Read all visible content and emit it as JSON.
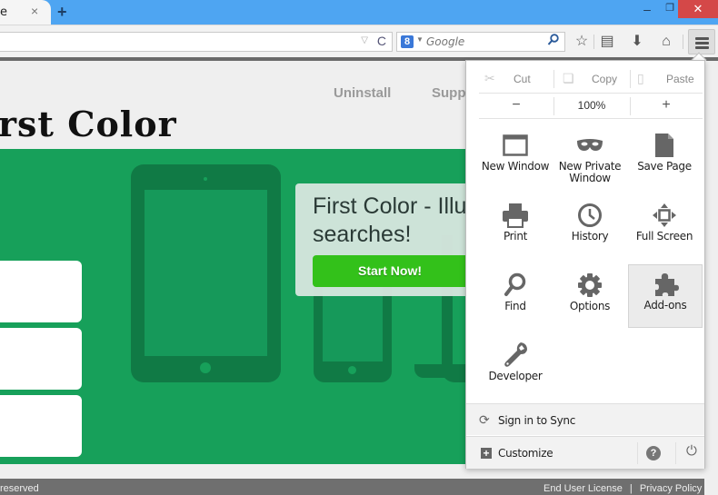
{
  "browser": {
    "tab_title": "e",
    "tab_close_icon": "×",
    "new_tab_icon": "+",
    "window_controls": {
      "minimize": "–",
      "maximize": "❐",
      "close": "✕"
    },
    "urlbar": {
      "value": "",
      "dropdown_icon": "▽",
      "reload_icon": "C"
    },
    "searchbar": {
      "engine_letter": "8",
      "placeholder": "Google",
      "go_icon": "⚲"
    },
    "toolbar_icons": {
      "bookmark": "☆",
      "reading_list": "▤",
      "download": "⬇",
      "home": "⌂"
    }
  },
  "site": {
    "logo": "rst Color",
    "nav": [
      "Uninstall",
      "Supp"
    ],
    "promo_title_line1": "First Color - Illu",
    "promo_title_line2": "searches!",
    "cta_label": "Start Now!",
    "footer_left": "reserved",
    "footer_links": [
      "End User License",
      "Privacy Policy"
    ],
    "footer_sep": "|",
    "colors": {
      "hero_green": "#17a05a",
      "device_green": "#107a45",
      "cta_green": "#33c11a"
    }
  },
  "menu": {
    "edit": [
      {
        "label": "Cut",
        "icon": "✂"
      },
      {
        "label": "Copy",
        "icon": "❏"
      },
      {
        "label": "Paste",
        "icon": "▯"
      }
    ],
    "zoom": {
      "minus": "−",
      "value": "100%",
      "plus": "+"
    },
    "items": [
      {
        "label": "New Window",
        "icon": "new-window"
      },
      {
        "label": "New Private Window",
        "icon": "mask"
      },
      {
        "label": "Save Page",
        "icon": "page"
      },
      {
        "label": "Print",
        "icon": "printer"
      },
      {
        "label": "History",
        "icon": "clock"
      },
      {
        "label": "Full Screen",
        "icon": "fullscreen"
      },
      {
        "label": "Find",
        "icon": "magnifier"
      },
      {
        "label": "Options",
        "icon": "gear"
      },
      {
        "label": "Add-ons",
        "icon": "puzzle",
        "selected": true
      },
      {
        "label": "Developer",
        "icon": "wrench"
      }
    ],
    "sync_label": "Sign in to Sync",
    "sync_icon": "⟳",
    "customize_label": "Customize",
    "customize_icon": "+",
    "help_icon": "?",
    "quit_icon": "⏻"
  }
}
